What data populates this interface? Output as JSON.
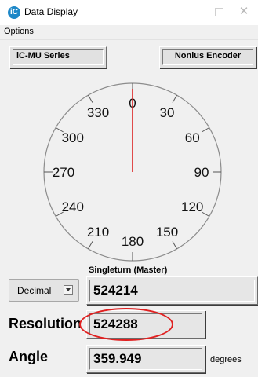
{
  "window": {
    "title": "Data Display",
    "app_icon_letter": "iC",
    "minimize_glyph": "—",
    "close_glyph": "✕"
  },
  "menu": {
    "items": [
      "Options"
    ]
  },
  "buttons": {
    "series_label": "iC-MU Series",
    "nonius_label": "Nonius Encoder"
  },
  "dial": {
    "tick_labels": [
      "0",
      "30",
      "60",
      "90",
      "120",
      "150",
      "180",
      "210",
      "240",
      "270",
      "300",
      "330"
    ],
    "needle_angle_deg": 0,
    "needle_color": "#dd2222"
  },
  "singleturn_label": "Singleturn (Master)",
  "format_select": {
    "selected": "Decimal"
  },
  "singleturn_value": "524214",
  "resolution": {
    "label": "Resolution",
    "value": "524288"
  },
  "angle": {
    "label": "Angle",
    "value": "359.949",
    "unit": "degrees"
  },
  "annotation": {
    "highlight_color": "#e02020"
  }
}
